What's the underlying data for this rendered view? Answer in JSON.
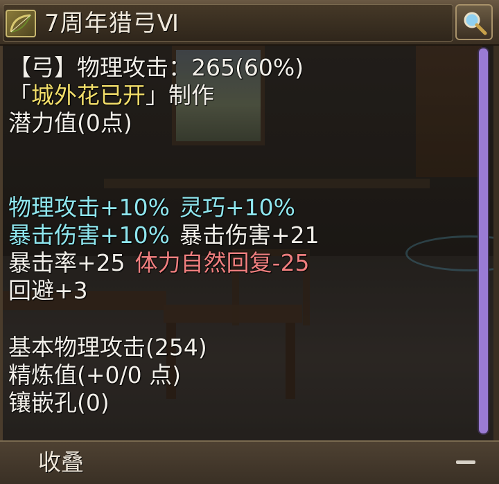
{
  "title": "7周年猎弓Ⅵ",
  "icons": {
    "item": "bow-icon",
    "search": "magnifier-icon",
    "collapse": "minus-icon"
  },
  "stats": {
    "weapon_type": "【弓】",
    "physical_attack_label": "物理攻击：",
    "physical_attack_value": "265(60%)",
    "crafter_open": "「",
    "crafter_name": "城外花已开",
    "crafter_close": "」",
    "crafter_suffix": "制作",
    "potential": "潜力值(0点)"
  },
  "bonuses": {
    "row1": [
      "物理攻击+10%",
      "灵巧+10%"
    ],
    "row2": [
      "暴击伤害+10%",
      "暴击伤害+21"
    ],
    "row3_white": "暴击率+25",
    "row3_red": "体力自然回复-25",
    "row4": "回避+3"
  },
  "base": {
    "base_attack": "基本物理攻击(254)",
    "refine": "精炼值(+0/0 点)",
    "sockets": "镶嵌孔(0)"
  },
  "footer": {
    "collapse_label": "收叠"
  },
  "colors": {
    "bonus_cyan": "#8fe6ee",
    "crafter_gold": "#f2de6a",
    "penalty_red": "#f07f7f",
    "text_white": "#f2efe9",
    "scrollbar_purple": "#9a7bd4"
  }
}
